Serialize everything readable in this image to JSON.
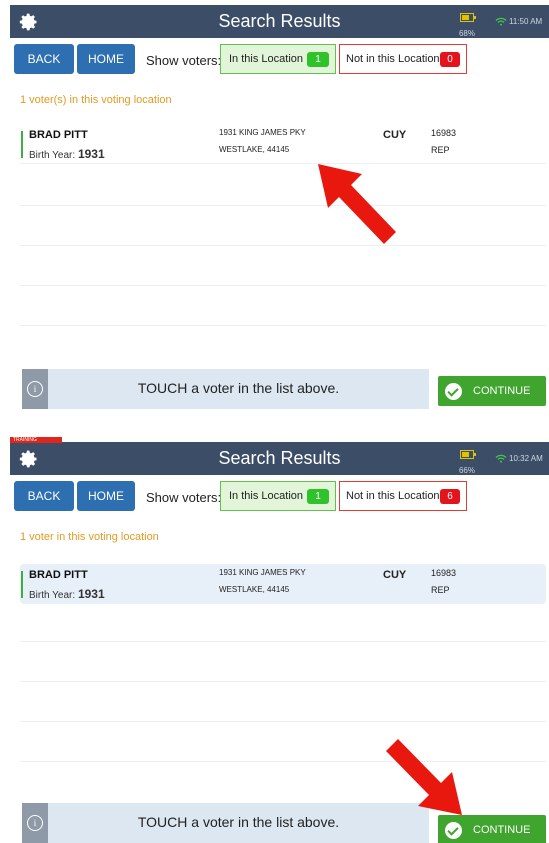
{
  "panels": [
    {
      "title": "Search Results",
      "battery": "68%",
      "battery_level": 0.68,
      "time": "11:50 AM",
      "back": "BACK",
      "home": "HOME",
      "show_voters_label": "Show voters:",
      "in_location_label": "In this Location",
      "in_location_count": "1",
      "not_location_label": "Not in this Location",
      "not_location_count": "0",
      "count_text": "1 voter(s) in this voting location",
      "voter": {
        "name": "BRAD PITT",
        "birth_label": "Birth Year:",
        "birth_year": "1931",
        "address1": "1931 KING JAMES PKY",
        "address2": "WESTLAKE, 44145",
        "county": "CUY",
        "precinct": "16983",
        "party": "REP",
        "selected": false
      },
      "instruction": "TOUCH a voter in the list above.",
      "continue_label": "CONTINUE"
    },
    {
      "training_label": "TRAINING",
      "title": "Search Results",
      "battery": "66%",
      "battery_level": 0.66,
      "time": "10:32 AM",
      "back": "BACK",
      "home": "HOME",
      "show_voters_label": "Show voters:",
      "in_location_label": "In this Location",
      "in_location_count": "1",
      "not_location_label": "Not in this Location",
      "not_location_count": "6",
      "count_text": "1 voter in this voting location",
      "voter": {
        "name": "BRAD PITT",
        "birth_label": "Birth Year:",
        "birth_year": "1931",
        "address1": "1931 KING JAMES PKY",
        "address2": "WESTLAKE, 44145",
        "county": "CUY",
        "precinct": "16983",
        "party": "REP",
        "selected": true
      },
      "instruction": "TOUCH a voter in the list above.",
      "continue_label": "CONTINUE"
    }
  ],
  "colors": {
    "header": "#3c4d68",
    "button_blue": "#2d6fb1",
    "continue_green": "#3fa52e",
    "annotation_arrow": "#e8180f",
    "count_orange": "#e19b23"
  },
  "icons": [
    "gear-icon",
    "battery-icon",
    "wifi-icon",
    "info-icon",
    "check-icon",
    "annotation-arrow"
  ]
}
